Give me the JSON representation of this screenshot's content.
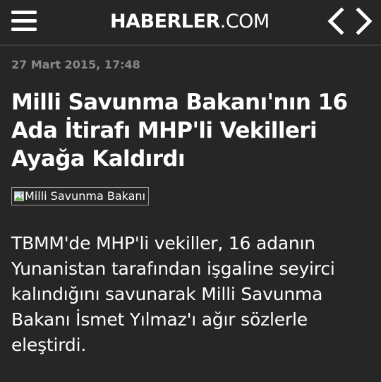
{
  "header": {
    "logo_main": "HABERLER",
    "logo_tld": ".COM",
    "menu_icon": "hamburger-menu-icon",
    "prev_icon": "chevron-left-icon",
    "next_icon": "chevron-right-icon"
  },
  "article": {
    "date": "27 Mart 2015, 17:48",
    "title": "Milli Savunma Bakanı'nın 16 Ada İtirafı MHP'li Vekilleri Ayağa Kaldırdı",
    "image_alt": "Milli Savunma Bakanı",
    "summary": "TBMM'de MHP'li vekiller, 16 adanın Yunanistan tarafından işgaline seyirci kalındığını savunarak Milli Savunma Bakanı İsmet Yılmaz'ı ağır sözlerle eleştirdi."
  },
  "colors": {
    "background": "#262626",
    "text": "#ffffff",
    "date_text": "#8a8a8a",
    "divider": "#3c3c3c"
  }
}
